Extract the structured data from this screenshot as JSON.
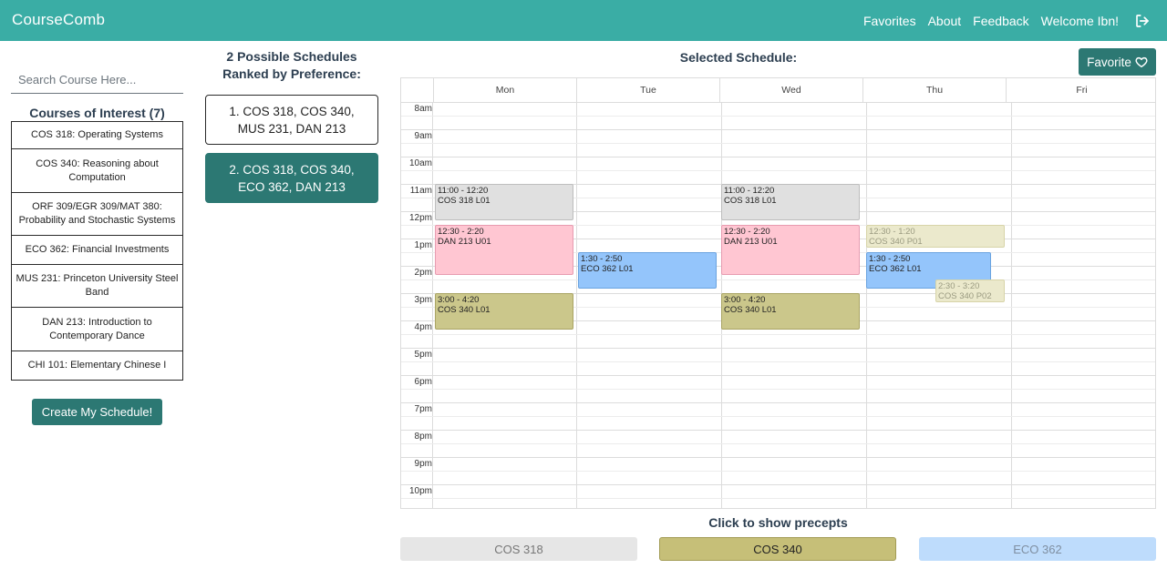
{
  "navbar": {
    "brand": "CourseComb",
    "links": [
      "Favorites",
      "About",
      "Feedback",
      "Welcome Ibn!"
    ],
    "logout_icon": "sign-out-icon"
  },
  "search": {
    "placeholder": "Search Course Here..."
  },
  "courses_of_interest": {
    "title": "Courses of Interest (7)",
    "items": [
      "COS 318: Operating Systems",
      "COS 340: Reasoning about Computation",
      "ORF 309/EGR 309/MAT 380: Probability and Stochastic Systems",
      "ECO 362: Financial Investments",
      "MUS 231: Princeton University Steel Band",
      "DAN 213: Introduction to Contemporary Dance",
      "CHI 101: Elementary Chinese I"
    ]
  },
  "create_button": "Create My Schedule!",
  "possible_schedules": {
    "title": "2 Possible Schedules Ranked by Preference:",
    "options": [
      "1. COS 318, COS 340, MUS 231, DAN 213",
      "2. COS 318, COS 340, ECO 362, DAN 213"
    ],
    "selected_index": 1
  },
  "selected_schedule": {
    "title": "Selected Schedule:",
    "favorite_label": "Favorite",
    "favorite_icon": "heart-outline-icon",
    "days": [
      "Mon",
      "Tue",
      "Wed",
      "Thu",
      "Fri"
    ],
    "hours": [
      "8am",
      "9am",
      "10am",
      "11am",
      "12pm",
      "1pm",
      "2pm",
      "3pm",
      "4pm",
      "5pm",
      "6pm",
      "7pm",
      "8pm",
      "9pm",
      "10pm"
    ],
    "events": [
      {
        "time": "11:00 - 12:20",
        "label": "COS 318 L01",
        "kind": "cos318",
        "day": "Mon"
      },
      {
        "time": "11:00 - 12:20",
        "label": "COS 318 L01",
        "kind": "cos318",
        "day": "Wed"
      },
      {
        "time": "12:30 - 2:20",
        "label": "DAN 213 U01",
        "kind": "dan213",
        "day": "Mon"
      },
      {
        "time": "12:30 - 2:20",
        "label": "DAN 213 U01",
        "kind": "dan213",
        "day": "Wed"
      },
      {
        "time": "3:00 - 4:20",
        "label": "COS 340 L01",
        "kind": "cos340",
        "day": "Mon"
      },
      {
        "time": "3:00 - 4:20",
        "label": "COS 340 L01",
        "kind": "cos340",
        "day": "Wed"
      },
      {
        "time": "1:30 - 2:50",
        "label": "ECO 362 L01",
        "kind": "eco362",
        "day": "Tue"
      },
      {
        "time": "1:30 - 2:50",
        "label": "ECO 362 L01",
        "kind": "eco362",
        "day": "Thu"
      },
      {
        "time": "12:30 - 1:20",
        "label": "COS 340 P01",
        "kind": "precept",
        "day": "Thu"
      },
      {
        "time": "2:30 - 3:20",
        "label": "COS 340 P02",
        "kind": "precept",
        "day": "Thu"
      }
    ]
  },
  "precepts": {
    "title": "Click to show precepts",
    "buttons": [
      "COS 318",
      "COS 340",
      "ECO 362"
    ],
    "active": "COS 340",
    "colors": {
      "COS 318": "#e6e6e6",
      "COS 340": "#c6bf78",
      "ECO 362": "#bedcfc"
    }
  },
  "colors": {
    "navbar": "#3aada5",
    "primary_button": "#2c7873",
    "cos318": "#e0e0e0",
    "dan213": "#ffc6d2",
    "cos340": "#cbc78b",
    "eco362": "#94c5fb"
  }
}
